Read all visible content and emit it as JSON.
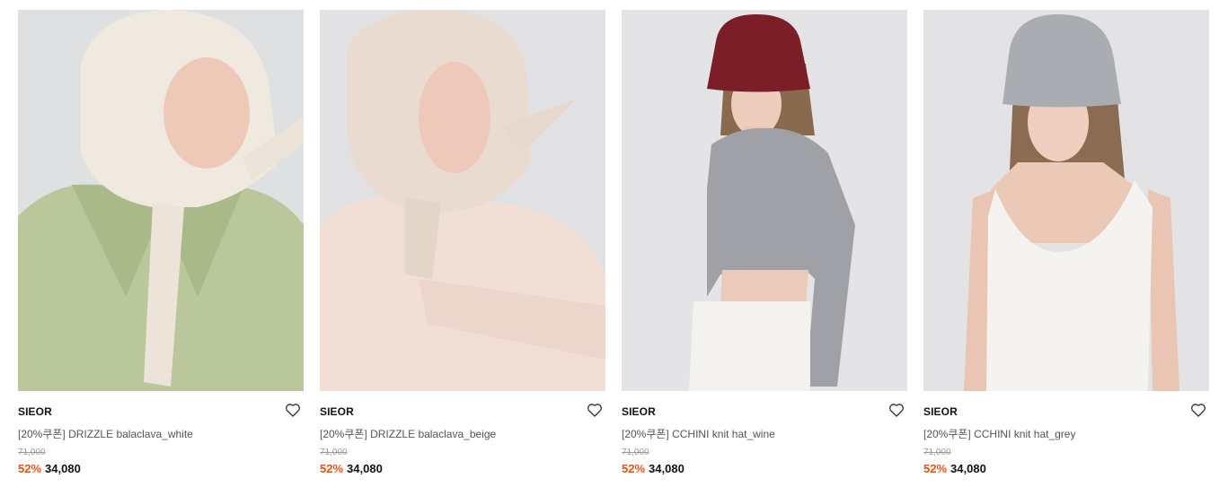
{
  "products": [
    {
      "image": "model wearing white padded balaclava hood and green coat",
      "brand": "SIEOR",
      "name": "[20%쿠폰] DRIZZLE balaclava_white",
      "original_price": "71,000",
      "discount": "52%",
      "price": "34,080",
      "wishlist_icon": "heart-outline-icon"
    },
    {
      "image": "model wearing beige padded balaclava hood and sheer top",
      "brand": "SIEOR",
      "name": "[20%쿠폰] DRIZZLE balaclava_beige",
      "original_price": "71,000",
      "discount": "52%",
      "price": "34,080",
      "wishlist_icon": "heart-outline-icon"
    },
    {
      "image": "model wearing wine knit bucket hat and grey crop sweater",
      "brand": "SIEOR",
      "name": "[20%쿠폰] CCHINI knit hat_wine",
      "original_price": "71,000",
      "discount": "52%",
      "price": "34,080",
      "wishlist_icon": "heart-outline-icon"
    },
    {
      "image": "model wearing grey knit bucket hat and white tank top",
      "brand": "SIEOR",
      "name": "[20%쿠폰] CCHINI knit hat_grey",
      "original_price": "71,000",
      "discount": "52%",
      "price": "34,080",
      "wishlist_icon": "heart-outline-icon"
    }
  ],
  "colors": {
    "discount": "#e2541f",
    "photo_background": "#e6e6e8"
  }
}
